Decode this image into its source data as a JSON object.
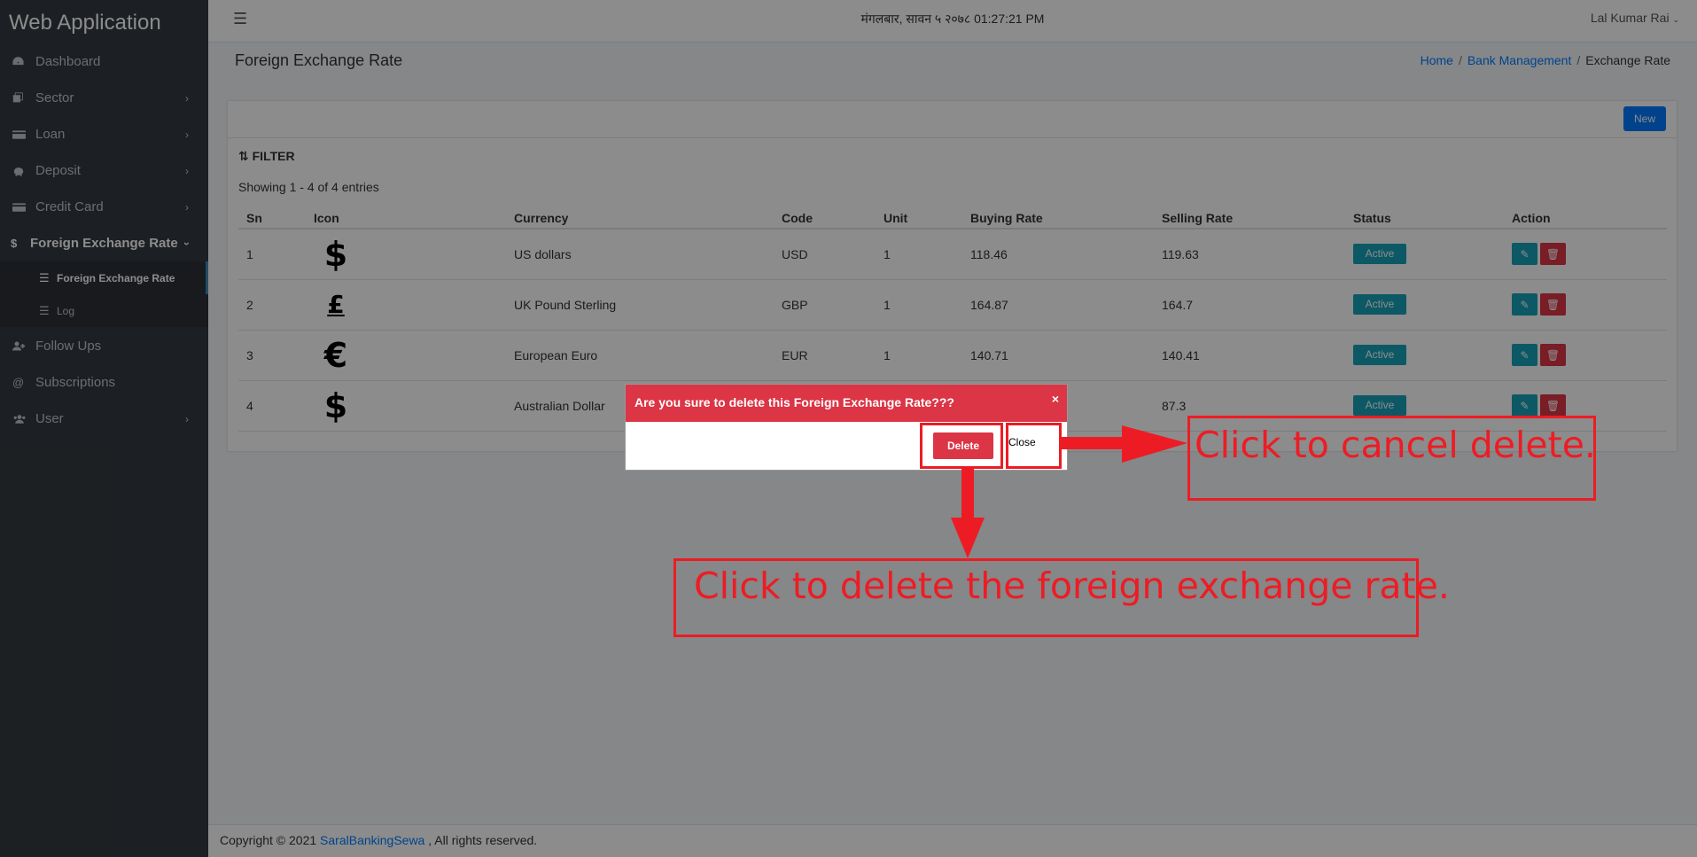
{
  "app": {
    "title": "Web Application"
  },
  "sidebar": {
    "items": [
      {
        "label": "Dashboard",
        "icon": "dashboard-icon",
        "has_children": false
      },
      {
        "label": "Sector",
        "icon": "sector-icon",
        "has_children": true
      },
      {
        "label": "Loan",
        "icon": "loan-icon",
        "has_children": true
      },
      {
        "label": "Deposit",
        "icon": "piggy-bank-icon",
        "has_children": true
      },
      {
        "label": "Credit Card",
        "icon": "credit-card-icon",
        "has_children": true
      },
      {
        "label": "Foreign Exchange Rate",
        "icon": "dollar-icon",
        "has_children": true,
        "expanded": true
      },
      {
        "label": "Follow Ups",
        "icon": "user-plus-icon",
        "has_children": false
      },
      {
        "label": "Subscriptions",
        "icon": "at-icon",
        "has_children": false
      },
      {
        "label": "User",
        "icon": "users-icon",
        "has_children": true
      }
    ],
    "subitems": [
      {
        "label": "Foreign Exchange Rate",
        "icon": "list-icon",
        "current": true
      },
      {
        "label": "Log",
        "icon": "list-icon",
        "current": false
      }
    ]
  },
  "topbar": {
    "datetime": "मंगलबार, सावन ५ २०७८ 01:27:21 PM",
    "user": "Lal Kumar Rai"
  },
  "header": {
    "title": "Foreign Exchange Rate",
    "breadcrumb": [
      "Home",
      "Bank Management",
      "Exchange Rate"
    ]
  },
  "card": {
    "new_label": "New",
    "filter_label": "FILTER",
    "showing": "Showing 1 - 4 of 4 entries"
  },
  "table": {
    "columns": [
      "Sn",
      "Icon",
      "Currency",
      "Code",
      "Unit",
      "Buying Rate",
      "Selling Rate",
      "Status",
      "Action"
    ],
    "rows": [
      {
        "sn": "1",
        "icon": "$",
        "currency": "US dollars",
        "code": "USD",
        "unit": "1",
        "buying": "118.46",
        "selling": "119.63",
        "status": "Active"
      },
      {
        "sn": "2",
        "icon": "£",
        "currency": "UK Pound Sterling",
        "code": "GBP",
        "unit": "1",
        "buying": "164.87",
        "selling": "164.7",
        "status": "Active"
      },
      {
        "sn": "3",
        "icon": "€",
        "currency": "European Euro",
        "code": "EUR",
        "unit": "1",
        "buying": "140.71",
        "selling": "140.41",
        "status": "Active"
      },
      {
        "sn": "4",
        "icon": "$",
        "currency": "Australian Dollar",
        "code": "",
        "unit": "",
        "buying": "",
        "selling": "87.3",
        "status": "Active"
      }
    ]
  },
  "footer": {
    "prefix": "Copyright © 2021 ",
    "link": "SaralBankingSewa",
    "suffix": " , All rights reserved."
  },
  "modal": {
    "title": "Are you sure to delete this Foreign Exchange Rate???",
    "close_x": "×",
    "delete_label": "Delete",
    "close_label": "Close"
  },
  "annotations": {
    "cancel": "Click to cancel delete.",
    "delete": "Click to delete the foreign exchange rate."
  },
  "colors": {
    "sidebar_bg": "#343a40",
    "accent": "#007bff",
    "danger": "#dc3545",
    "info": "#17a2b8",
    "annotation_red": "#ed1c24"
  }
}
